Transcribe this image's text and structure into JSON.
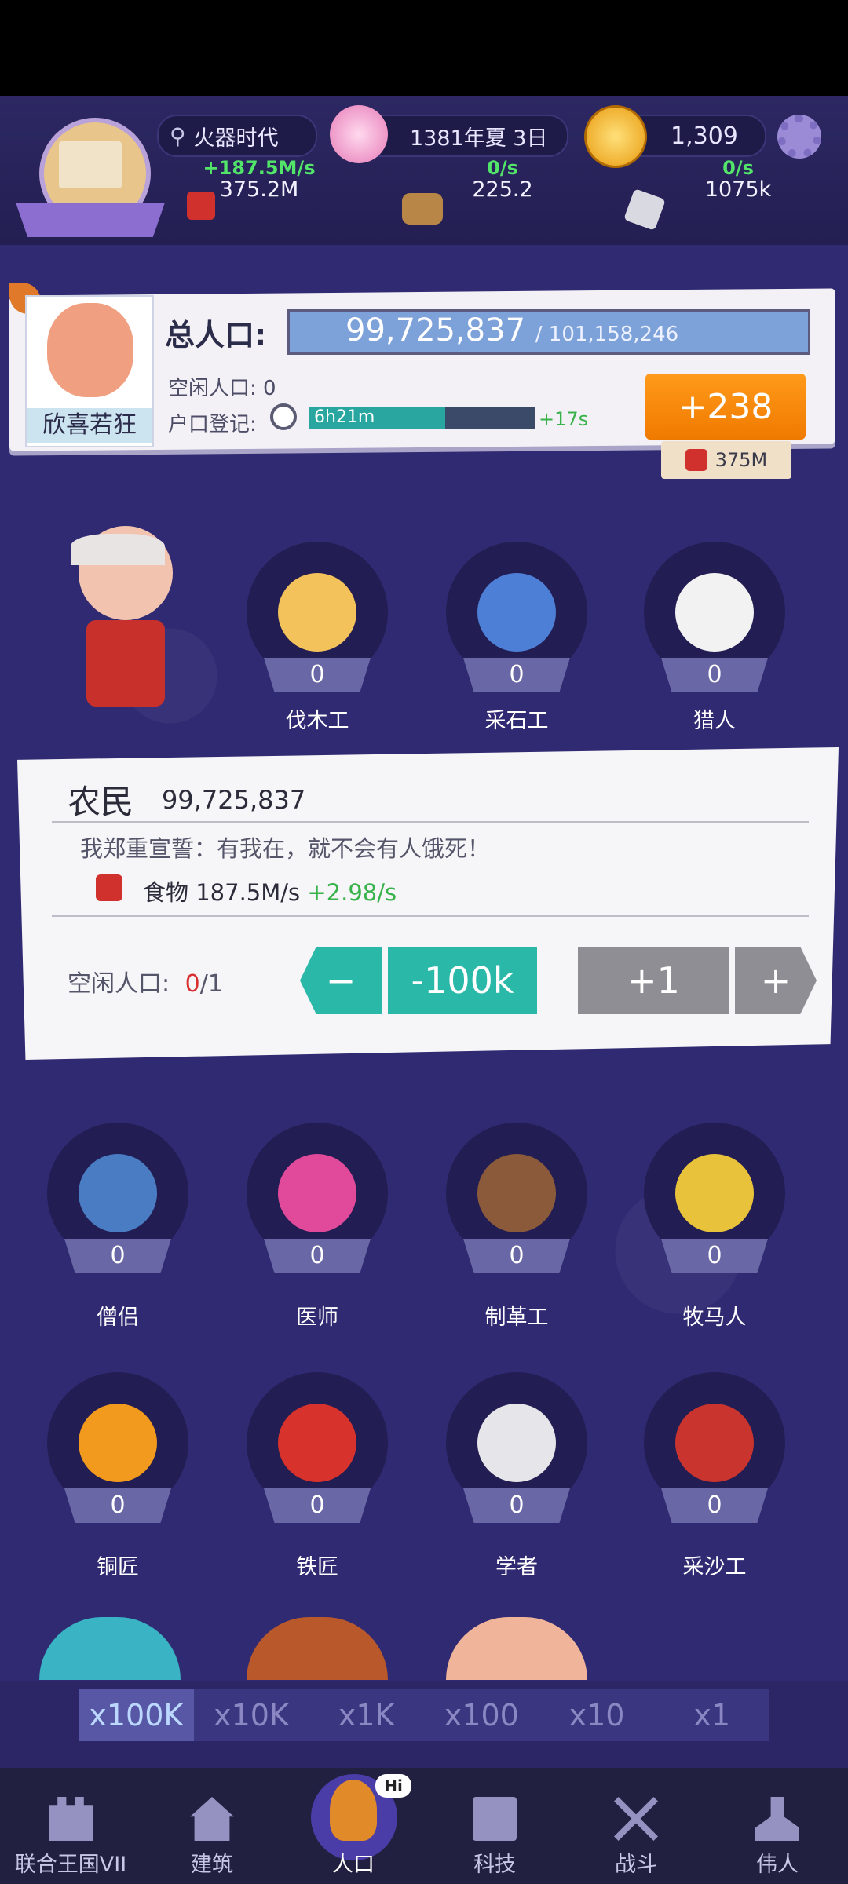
{
  "header": {
    "era_label": "火器时代",
    "date_label": "1381年夏 3日",
    "coins": "1,309",
    "resources": [
      {
        "name": "food",
        "rate": "+187.5M/s",
        "value": "375.2M",
        "icon": "apple-crate-icon"
      },
      {
        "name": "wood",
        "rate": "0/s",
        "value": "225.2",
        "icon": "wood-logs-icon"
      },
      {
        "name": "stone",
        "rate": "0/s",
        "value": "1075k",
        "icon": "stone-icon"
      }
    ]
  },
  "population": {
    "mood": "欣喜若狂",
    "total_label": "总人口:",
    "total_value": "99,725,837",
    "total_max": "/ 101,158,246",
    "idle_label": "空闲人口: 0",
    "registry_label": "户口登记:",
    "timer": "6h21m",
    "timer_progress": 0.6,
    "timer_bonus": "+17s",
    "add_button": "+238",
    "cost": "375M"
  },
  "top_jobs": [
    {
      "label": "伐木工",
      "count": "0",
      "icon": "lumberjack-avatar"
    },
    {
      "label": "采石工",
      "count": "0",
      "icon": "quarryman-avatar"
    },
    {
      "label": "猎人",
      "count": "0",
      "icon": "hunter-avatar"
    }
  ],
  "farmer_card": {
    "title": "农民",
    "count": "99,725,837",
    "motto": "我郑重宣誓：有我在，就不会有人饿死！",
    "food_label": "食物 187.5M/s",
    "food_bonus": "+2.98/s",
    "idle_label": "空闲人口:",
    "idle_value": "0",
    "idle_max": "/1",
    "minus_label": "−",
    "dec_label": "-100k",
    "inc_label": "+1",
    "plus_label": "+"
  },
  "jobs": [
    {
      "label": "僧侣",
      "count": "0"
    },
    {
      "label": "医师",
      "count": "0"
    },
    {
      "label": "制革工",
      "count": "0"
    },
    {
      "label": "牧马人",
      "count": "0"
    },
    {
      "label": "铜匠",
      "count": "0"
    },
    {
      "label": "铁匠",
      "count": "0"
    },
    {
      "label": "学者",
      "count": "0"
    },
    {
      "label": "采沙工",
      "count": "0"
    }
  ],
  "multipliers": [
    "x100K",
    "x10K",
    "x1K",
    "x100",
    "x10",
    "x1"
  ],
  "nav": [
    {
      "label": "联合王国VII",
      "icon": "castle-icon"
    },
    {
      "label": "建筑",
      "icon": "house-icon"
    },
    {
      "label": "人口",
      "icon": "citizen-icon",
      "badge": "Hi"
    },
    {
      "label": "科技",
      "icon": "book-icon"
    },
    {
      "label": "战斗",
      "icon": "crossed-swords-icon"
    },
    {
      "label": "伟人",
      "icon": "bust-icon"
    }
  ]
}
